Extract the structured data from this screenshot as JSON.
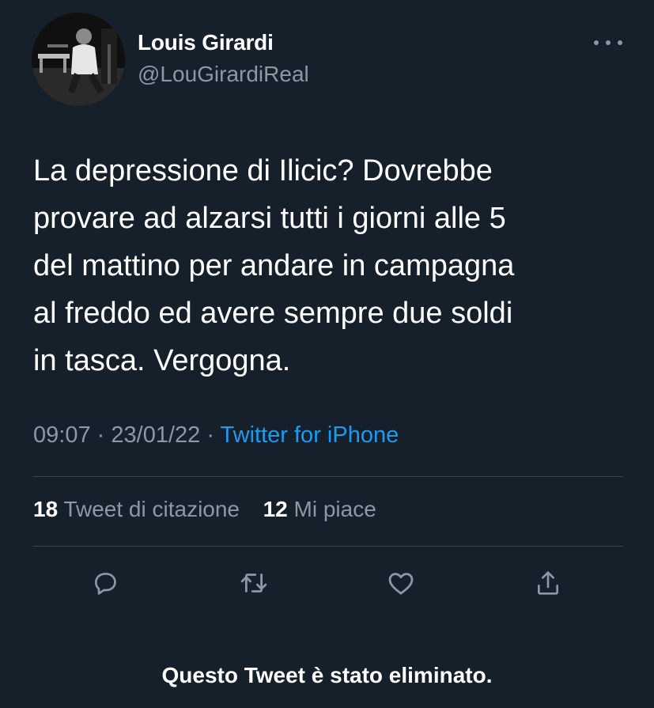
{
  "user": {
    "name": "Louis Girardi",
    "handle": "@LouGirardiReal",
    "avatar": "profile-photo"
  },
  "tweet": {
    "text": "La depressione di Ilicic? Dovrebbe\nprovare ad alzarsi tutti i giorni alle 5\ndel mattino per andare in campagna\nal freddo ed avere sempre due soldi\nin tasca. Vergogna.",
    "time": "09:07",
    "separator": "·",
    "date": "23/01/22",
    "source": "Twitter for iPhone"
  },
  "stats": {
    "quote_count": "18",
    "quote_label": "Tweet di citazione",
    "like_count": "12",
    "like_label": "Mi piace"
  },
  "actions": [
    "reply-icon",
    "retweet-icon",
    "like-icon",
    "share-icon"
  ],
  "caption": "Questo Tweet è stato eliminato.",
  "colors": {
    "background": "#15202b",
    "text": "#ffffff",
    "muted": "#8b98a5",
    "link": "#1d9bf0",
    "divider": "#38444d"
  }
}
